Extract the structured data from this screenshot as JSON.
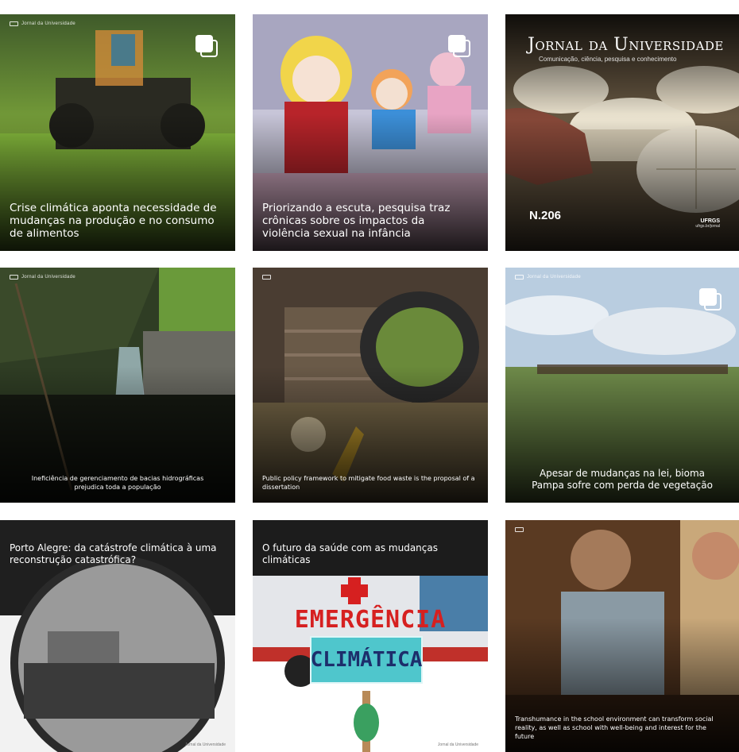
{
  "grid": {
    "posts": [
      {
        "tag": "",
        "headline": "Crise climática aponta necessidade de mudanças na produção e no consumo de alimentos",
        "brand": "Jornal da Universidade",
        "has_multi_icon": true
      },
      {
        "tag": "",
        "headline": "Priorizando a escuta, pesquisa traz crônicas sobre os impactos da violência sexual na infância",
        "has_multi_icon": true
      },
      {
        "journal_title": "Jornal da Universidade",
        "journal_subtitle": "Comunicação, ciência, pesquisa e conhecimento",
        "issue": "N.206",
        "issue_date": "",
        "logo": "UFRGS",
        "logo_sub": "ufrgs.br/jornal"
      },
      {
        "tag": "",
        "headline": "Ineficiência de gerenciamento de bacias hidrográficas prejudica toda a população",
        "brand": "Jornal da Universidade"
      },
      {
        "tag": "",
        "headline": "Public policy framework to mitigate food waste is the proposal of a dissertation"
      },
      {
        "tag": "",
        "headline": "Apesar de mudanças na lei, bioma Pampa sofre com perda de vegetação",
        "brand": "Jornal da Universidade",
        "has_multi_icon": true
      },
      {
        "tag": "",
        "headline": "Porto Alegre: da catástrofe climática à uma reconstrução catastrófica?",
        "footer": "Jornal da Universidade"
      },
      {
        "tag": "",
        "headline": "O futuro da saúde com as mudanças climáticas",
        "banner_text": "EMERGÊNCIA",
        "sign_text": "CLIMÁTICA",
        "footer": "Jornal da Universidade"
      },
      {
        "tag": "",
        "headline": "Transhumance in the school environment can transform social reality, as well as school with well-being and interest for the future"
      }
    ]
  },
  "colors": {
    "tag": "#1ba9b8",
    "emergency_red": "#d62020",
    "sign_bg": "#4fc6cc"
  },
  "icons": {
    "multi": "multiple-images-icon",
    "brand": "brand-logo-icon"
  }
}
